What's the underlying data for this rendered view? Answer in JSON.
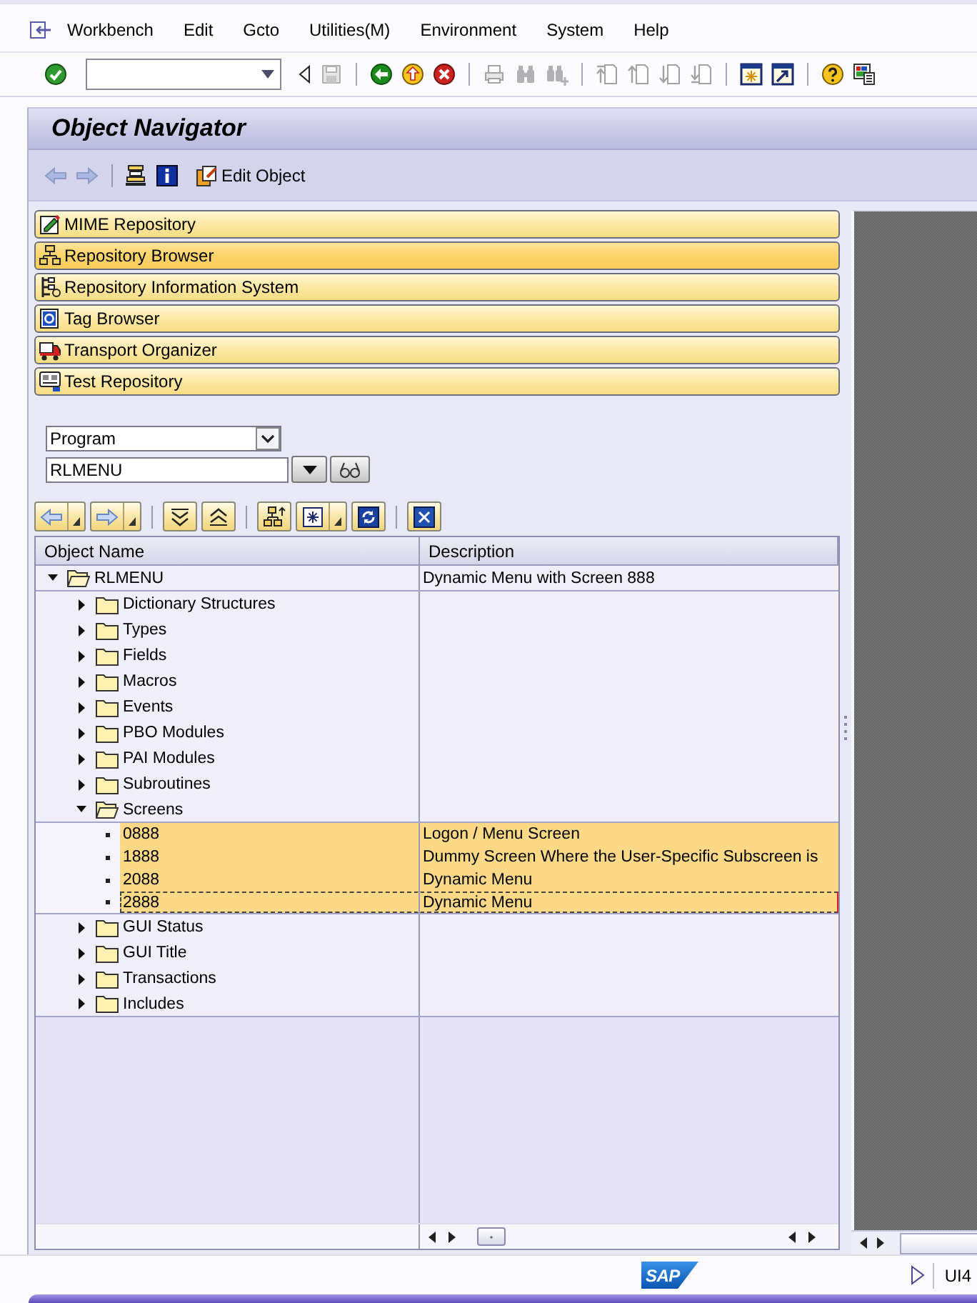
{
  "menu_bar": {
    "items": [
      "Workbench",
      "Edit",
      "Gcto",
      "Utilities(M)",
      "Environment",
      "System",
      "Help"
    ]
  },
  "system_toolbar": {
    "buttons": [
      {
        "disabled": false
      },
      {
        "disabled": false
      },
      {
        "disabled": true
      },
      {
        "disabled": false
      },
      {
        "disabled": false
      },
      {
        "disabled": false
      },
      {
        "disabled": true
      },
      {
        "disabled": true
      },
      {
        "disabled": true
      },
      {
        "disabled": true
      },
      {
        "disabled": true
      },
      {
        "disabled": true
      },
      {
        "disabled": true
      },
      {
        "disabled": false
      },
      {
        "disabled": false
      },
      {
        "disabled": false
      },
      {
        "disabled": false
      }
    ]
  },
  "window": {
    "title": "Object Navigator"
  },
  "application_toolbar": {
    "buttons": [
      {
        "disabled": true
      },
      {
        "disabled": true
      },
      {
        "disabled": false
      },
      {
        "disabled": false
      },
      {
        "label": "Edit Object",
        "disabled": false
      }
    ]
  },
  "navigator": {
    "buttons": [
      {
        "label": "MIME Repository",
        "selected": false
      },
      {
        "label": "Repository Browser",
        "selected": true
      },
      {
        "label": "Repository Information System",
        "selected": false
      },
      {
        "label": "Tag Browser",
        "selected": false
      },
      {
        "label": "Transport Organizer",
        "selected": false
      },
      {
        "label": "Test Repository",
        "selected": false
      }
    ]
  },
  "object_selection": {
    "type": {
      "value": "Program"
    },
    "name": {
      "value": "RLMENU"
    }
  },
  "tree": {
    "columns": [
      "Object Name",
      "Description"
    ],
    "nodes": [
      {
        "name": "RLMENU",
        "description": "Dynamic Menu with Screen 888",
        "kind": "folder",
        "expanded": true,
        "selected": false,
        "focused": false,
        "children": [
          {
            "name": "Dictionary Structures",
            "kind": "folder",
            "expanded": false,
            "selected": false,
            "focused": false
          },
          {
            "name": "Types",
            "kind": "folder",
            "expanded": false,
            "selected": false,
            "focused": false
          },
          {
            "name": "Fields",
            "kind": "folder",
            "expanded": false,
            "selected": false,
            "focused": false
          },
          {
            "name": "Macros",
            "kind": "folder",
            "expanded": false,
            "selected": false,
            "focused": false
          },
          {
            "name": "Events",
            "kind": "folder",
            "expanded": false,
            "selected": false,
            "focused": false
          },
          {
            "name": "PBO Modules",
            "kind": "folder",
            "expanded": false,
            "selected": false,
            "focused": false
          },
          {
            "name": "PAI Modules",
            "kind": "folder",
            "expanded": false,
            "selected": false,
            "focused": false
          },
          {
            "name": "Subroutines",
            "kind": "folder",
            "expanded": false,
            "selected": false,
            "focused": false
          },
          {
            "name": "Screens",
            "kind": "folder",
            "expanded": true,
            "selected": false,
            "focused": false,
            "children": [
              {
                "name": "0888",
                "description": "Logon / Menu Screen",
                "kind": "leaf",
                "selected": true,
                "focused": false
              },
              {
                "name": "1888",
                "description": "Dummy Screen Where the User-Specific Subscreen is",
                "kind": "leaf",
                "selected": true,
                "focused": false
              },
              {
                "name": "2088",
                "description": "Dynamic Menu",
                "kind": "leaf",
                "selected": true,
                "focused": false
              },
              {
                "name": "2888",
                "description": "Dynamic Menu",
                "kind": "leaf",
                "selected": true,
                "focused": true
              }
            ]
          },
          {
            "name": "GUI Status",
            "kind": "folder",
            "expanded": false,
            "selected": false,
            "focused": false
          },
          {
            "name": "GUI Title",
            "kind": "folder",
            "expanded": false,
            "selected": false,
            "focused": false
          },
          {
            "name": "Transactions",
            "kind": "folder",
            "expanded": false,
            "selected": false,
            "focused": false
          },
          {
            "name": "Includes",
            "kind": "folder",
            "expanded": false,
            "selected": false,
            "focused": false
          }
        ]
      }
    ]
  },
  "status_bar": {
    "logo": "SAP",
    "system": "UI4"
  }
}
